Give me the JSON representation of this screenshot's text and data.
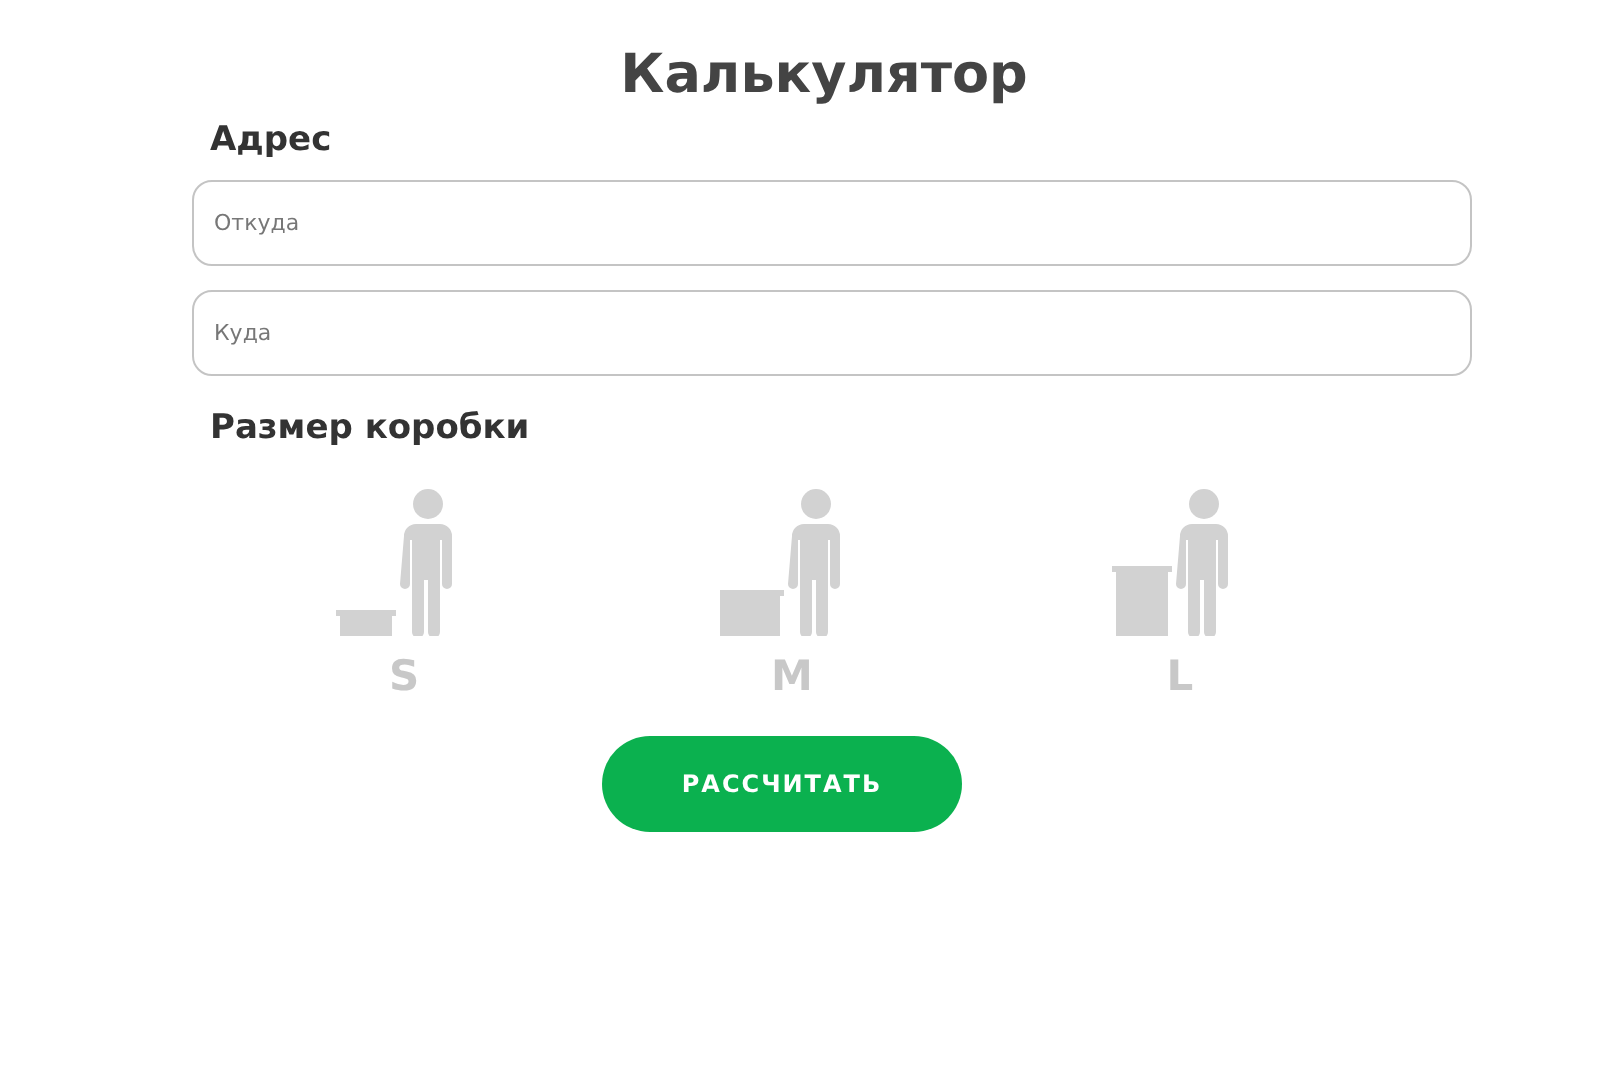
{
  "title": "Калькулятор",
  "address": {
    "label": "Адрес",
    "fields": [
      {
        "placeholder": "Откуда"
      },
      {
        "placeholder": "Куда"
      }
    ]
  },
  "box_size": {
    "label": "Размер коробки",
    "options": [
      {
        "label": "S",
        "kind": "small",
        "selected": false
      },
      {
        "label": "M",
        "kind": "medium",
        "selected": false
      },
      {
        "label": "L",
        "kind": "large",
        "selected": false
      }
    ]
  },
  "button": "РАССЧИТАТЬ"
}
